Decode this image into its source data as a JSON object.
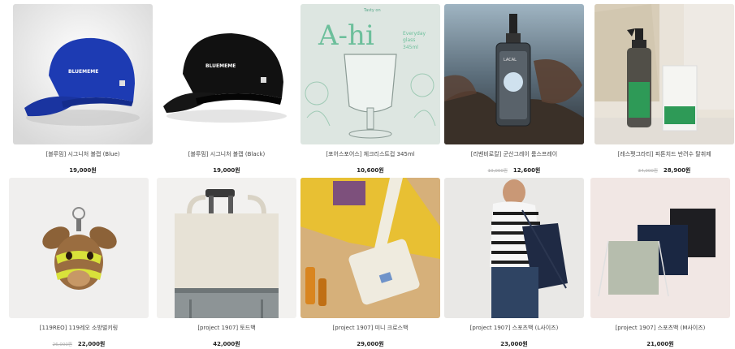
{
  "products": [
    {
      "title": "[블루밈] 시그니처 볼캡 (Blue)",
      "price": "19,000원",
      "old_price": ""
    },
    {
      "title": "[블루밈] 시그니처 볼캡 (Black)",
      "price": "19,000원",
      "old_price": ""
    },
    {
      "title": "[포어스포어스] 체크리스트컵 345ml",
      "price": "10,600원",
      "old_price": "",
      "image_text": {
        "brand": "A-hi",
        "script1": "Everyday",
        "script2": "glass",
        "script3": "345ml",
        "top": "Tasty on"
      }
    },
    {
      "title": "[리벤비로칼] 군산그레이 룸스프레이",
      "price": "12,600원",
      "old_price": "19,000원",
      "image_text": {
        "label": "LACAL"
      }
    },
    {
      "title": "[레스펫그라티] 피톤치드 반려수 탈취제",
      "price": "28,900원",
      "old_price": "34,000원"
    },
    {
      "title": "[119REO] 119레오 소방벌키링",
      "price": "22,000원",
      "old_price": "26,000원"
    },
    {
      "title": "[project 1907] 토드백",
      "price": "42,000원",
      "old_price": ""
    },
    {
      "title": "[project 1907] 미니 크로스백",
      "price": "29,000원",
      "old_price": ""
    },
    {
      "title": "[project 1907] 스포츠백 (L사이즈)",
      "price": "23,000원",
      "old_price": ""
    },
    {
      "title": "[project 1907] 스포츠백 (M사이즈)",
      "price": "21,000원",
      "old_price": ""
    }
  ],
  "cap_logo": "BLUEMEME"
}
